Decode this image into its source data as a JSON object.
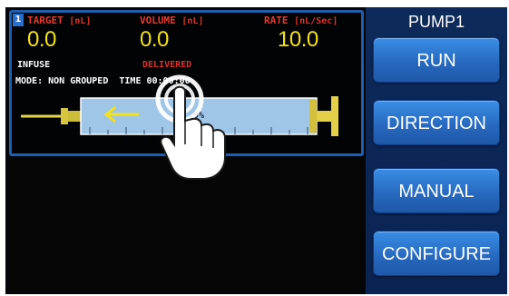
{
  "panel": {
    "number": "1",
    "headers": {
      "target": "TARGET",
      "target_unit": "[nL]",
      "volume": "VOLUME",
      "volume_unit": "[nL]",
      "rate": "RATE",
      "rate_unit": "[nL/Sec]"
    },
    "values": {
      "target": "0.0",
      "volume": "0.0",
      "rate": "10.0"
    },
    "labels": {
      "infuse": "INFUSE",
      "delivered": "DELIVERED"
    },
    "mode_line": "MODE: NON GROUPED  TIME 00:00:00",
    "syringe_fill_percent": "0%"
  },
  "sidebar": {
    "title": "PUMP1",
    "buttons": [
      "RUN",
      "DIRECTION",
      "MANUAL",
      "CONFIGURE"
    ]
  },
  "colors": {
    "header_red": "#e33a2f",
    "value_yellow": "#f3e21a",
    "button_blue": "#2667bd",
    "panel_border": "#1f5fb0"
  },
  "icons": [
    "pointing-hand-icon",
    "direction-arrow-icon"
  ]
}
